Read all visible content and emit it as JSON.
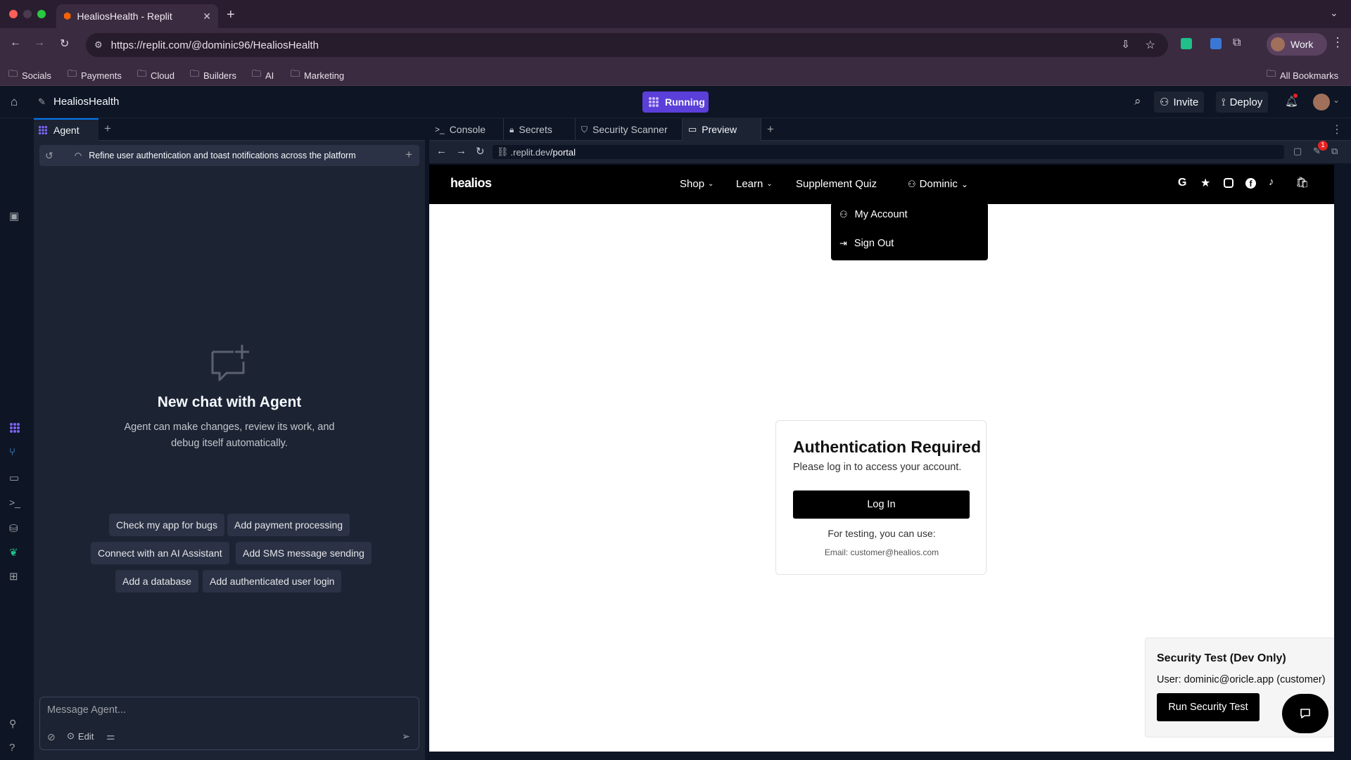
{
  "browser": {
    "tab_title": "HealiosHealth - Replit",
    "url": "https://replit.com/@dominic96/HealiosHealth",
    "profile_label": "Work",
    "bookmarks": [
      "Socials",
      "Payments",
      "Cloud",
      "Builders",
      "AI",
      "Marketing"
    ],
    "all_bookmarks": "All Bookmarks"
  },
  "replit": {
    "project_name": "HealiosHealth",
    "run_status": "Running",
    "invite_label": "Invite",
    "deploy_label": "Deploy",
    "accent": "#5b3fd9"
  },
  "agent": {
    "tab_label": "Agent",
    "thread_title": "Refine user authentication and toast notifications across the platform",
    "empty_title": "New chat with Agent",
    "empty_desc_line1": "Agent can make changes, review its work, and",
    "empty_desc_line2": "debug itself automatically.",
    "suggestions": [
      "Check my app for bugs",
      "Add payment processing",
      "Connect with an AI Assistant",
      "Add SMS message sending",
      "Add a database",
      "Add authenticated user login"
    ],
    "input_placeholder": "Message Agent...",
    "edit_label": "Edit"
  },
  "workspace_tabs": [
    "Console",
    "Secrets",
    "Security Scanner",
    "Preview"
  ],
  "preview": {
    "url_prefix": ".replit.dev",
    "url_path": "/portal",
    "notification_count": "1",
    "site": {
      "logo": "healios",
      "nav": [
        "Shop",
        "Learn",
        "Supplement Quiz"
      ],
      "user_menu": "Dominic",
      "dropdown": [
        "My Account",
        "Sign Out"
      ],
      "auth_title": "Authentication Required",
      "auth_subtitle": "Please log in to access your account.",
      "login_label": "Log In",
      "testing_note": "For testing, you can use:",
      "testing_email": "Email: customer@healios.com",
      "security_title": "Security Test (Dev Only)",
      "security_user": "User: dominic@oricle.app (customer)",
      "security_button": "Run Security Test"
    }
  }
}
